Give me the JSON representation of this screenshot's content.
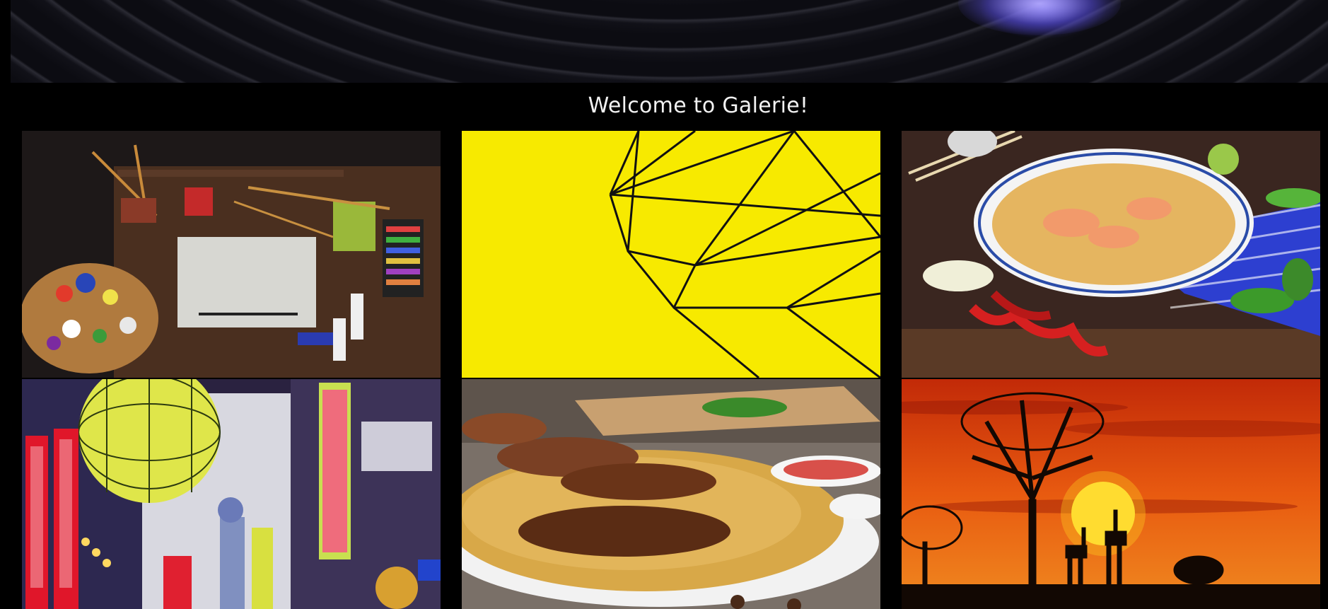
{
  "page": {
    "title": "Welcome to Galerie!"
  },
  "gallery": {
    "images": [
      {
        "subject": "art-supplies-on-desk"
      },
      {
        "subject": "yellow-wire-geometric"
      },
      {
        "subject": "curry-soup-bowl"
      },
      {
        "subject": "osaka-street-signs"
      },
      {
        "subject": "biryani-plate"
      },
      {
        "subject": "savanna-sunset-giraffes"
      }
    ]
  },
  "colors": {
    "background": "#000000",
    "title_text": "#f2f2f2",
    "accent_glow": "#6a5cff"
  }
}
